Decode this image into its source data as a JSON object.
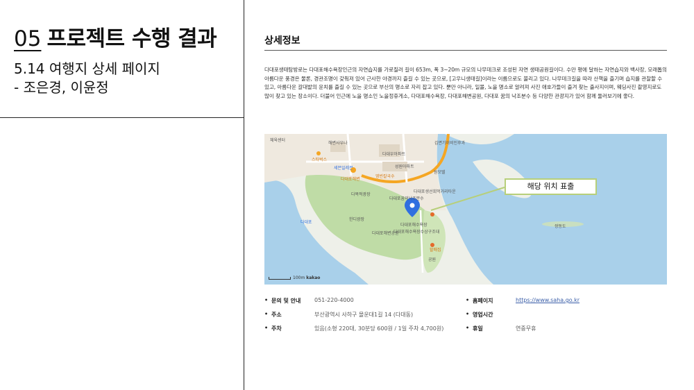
{
  "header": {
    "number": "05",
    "title": "프로젝트 수행 결과",
    "subtitle": "5.14 여행지 상세 페이지",
    "authors": "- 조은경, 이윤정"
  },
  "detail": {
    "section_title": "상세정보",
    "description": "다대포생태탐방로는 다대포해수욕장인근의 자연습지를 가로질러 길이 653m, 폭 3~20m 규모의 나무데크로 조성된 자연 생태공원길이다. 수만 평에 달하는 자연습지와 백사장, 모래톱의 아름다운 풍경은 물론, 경관조명이 갖춰져 있어 근사한 야경까지 즐길 수 있는 곳으로, [고우니생태길]이라는 이름으로도 불리고 있다. 나무데크길을 따라 산책을 즐기며 습지를 관찰할 수 있고, 아름다운 갈대밭의 윤치를 즐길 수 있는 곳으로 부산의 명소로 자리 잡고 있다. 뿐만 아니라, 일몰, 노을 명소로 알려져 사진 애호가들이 즐겨 찾는 출사지이며, 웨딩사진 촬영지로도 많이 찾고 있는 장소이다. 더불어 인근에 노을 명소인 노을정휴게소, 다대포해수욕장, 다대포해변공원, 다대포 꿈의 낙조분수 등 다양한 관광지가 있어 함께 둘러보기에 좋다."
  },
  "map": {
    "callout": "해당 위치 표출",
    "scale_label": "100m",
    "brand": "kakao",
    "labels": [
      "체육센터",
      "해변사우나",
      "다대우아파트",
      "김면기이비인후과",
      "스타벅스",
      "세븐일레븐",
      "성원아파트",
      "원모텔",
      "다대포해변",
      "영빈칼국수",
      "다대포생선회먹거리타운",
      "다목적광장",
      "다대포꿈의낙조분수",
      "다대포",
      "한디광장",
      "다대포해수욕장",
      "다대포해변공원",
      "다대포해수욕장수상구조대",
      "할매집",
      "공원",
      "쌍동도"
    ]
  },
  "info": {
    "left": [
      {
        "label": "문의 및 안내",
        "value": "051-220-4000"
      },
      {
        "label": "주소",
        "value": "부산광역시 사하구 몰운대1길 14 (다대동)"
      },
      {
        "label": "주차",
        "value": "있음(소형 220대, 30분당 600원 / 1일 주차 4,700원)"
      }
    ],
    "right": [
      {
        "label": "홈페이지",
        "value": "https://www.saha.go.kr"
      },
      {
        "label": "영업시간",
        "value": ""
      },
      {
        "label": "휴일",
        "value": "연중무휴"
      }
    ]
  },
  "colors": {
    "water": "#a9d0ea",
    "park": "#bfdca6",
    "callout_border": "#b7cf7a",
    "pin": "#2f6fe0",
    "road": "#f5a623"
  }
}
